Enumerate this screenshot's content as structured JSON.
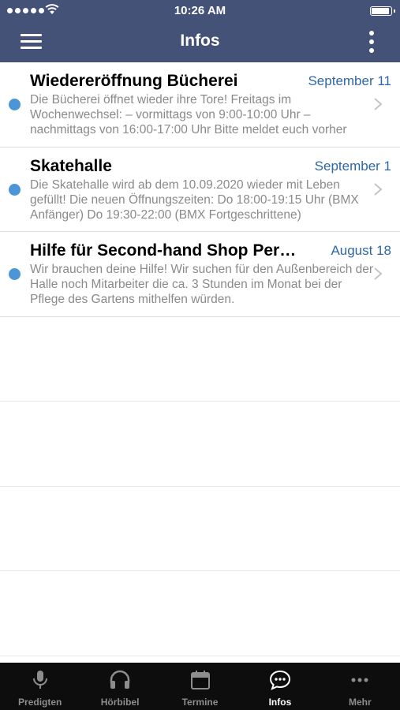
{
  "status_bar": {
    "time": "10:26 AM"
  },
  "nav": {
    "title": "Infos"
  },
  "infos": [
    {
      "title": "Wiedereröffnung Bücherei",
      "date": "September 11",
      "preview": "Die Bücherei öffnet wieder ihre Tore! Freitags im Wochenwechsel: – vormittags von 9:00-10:00 Uhr – nachmittags von 16:00-17:00 Uhr Bitte meldet euch vorher"
    },
    {
      "title": "Skatehalle",
      "date": "September 1",
      "preview": "Die Skatehalle wird ab dem 10.09.2020 wieder mit Leben gefüllt! Die neuen Öffnungszeiten: Do 18:00-19:15 Uhr (BMX Anfänger) Do 19:30-22:00 (BMX Fortgeschrittene)"
    },
    {
      "title": "Hilfe für Second-hand Shop Perm...",
      "date": "August 18",
      "preview": "Wir brauchen deine Hilfe! Wir suchen für den Außenbereich der Halle noch Mitarbeiter die ca. 3 Stunden im Monat bei der Pflege des Gartens mithelfen würden."
    }
  ],
  "tabs": [
    {
      "label": "Predigten",
      "icon": "microphone-icon"
    },
    {
      "label": "Hörbibel",
      "icon": "headphones-icon"
    },
    {
      "label": "Termine",
      "icon": "calendar-icon"
    },
    {
      "label": "Infos",
      "icon": "chat-bubble-icon",
      "active": true
    },
    {
      "label": "Mehr",
      "icon": "more-dots-icon"
    }
  ],
  "colors": {
    "header": "#445277",
    "unread_dot": "#4c96d7",
    "date": "#2f67a3",
    "tabbar": "#0d0d0d"
  }
}
